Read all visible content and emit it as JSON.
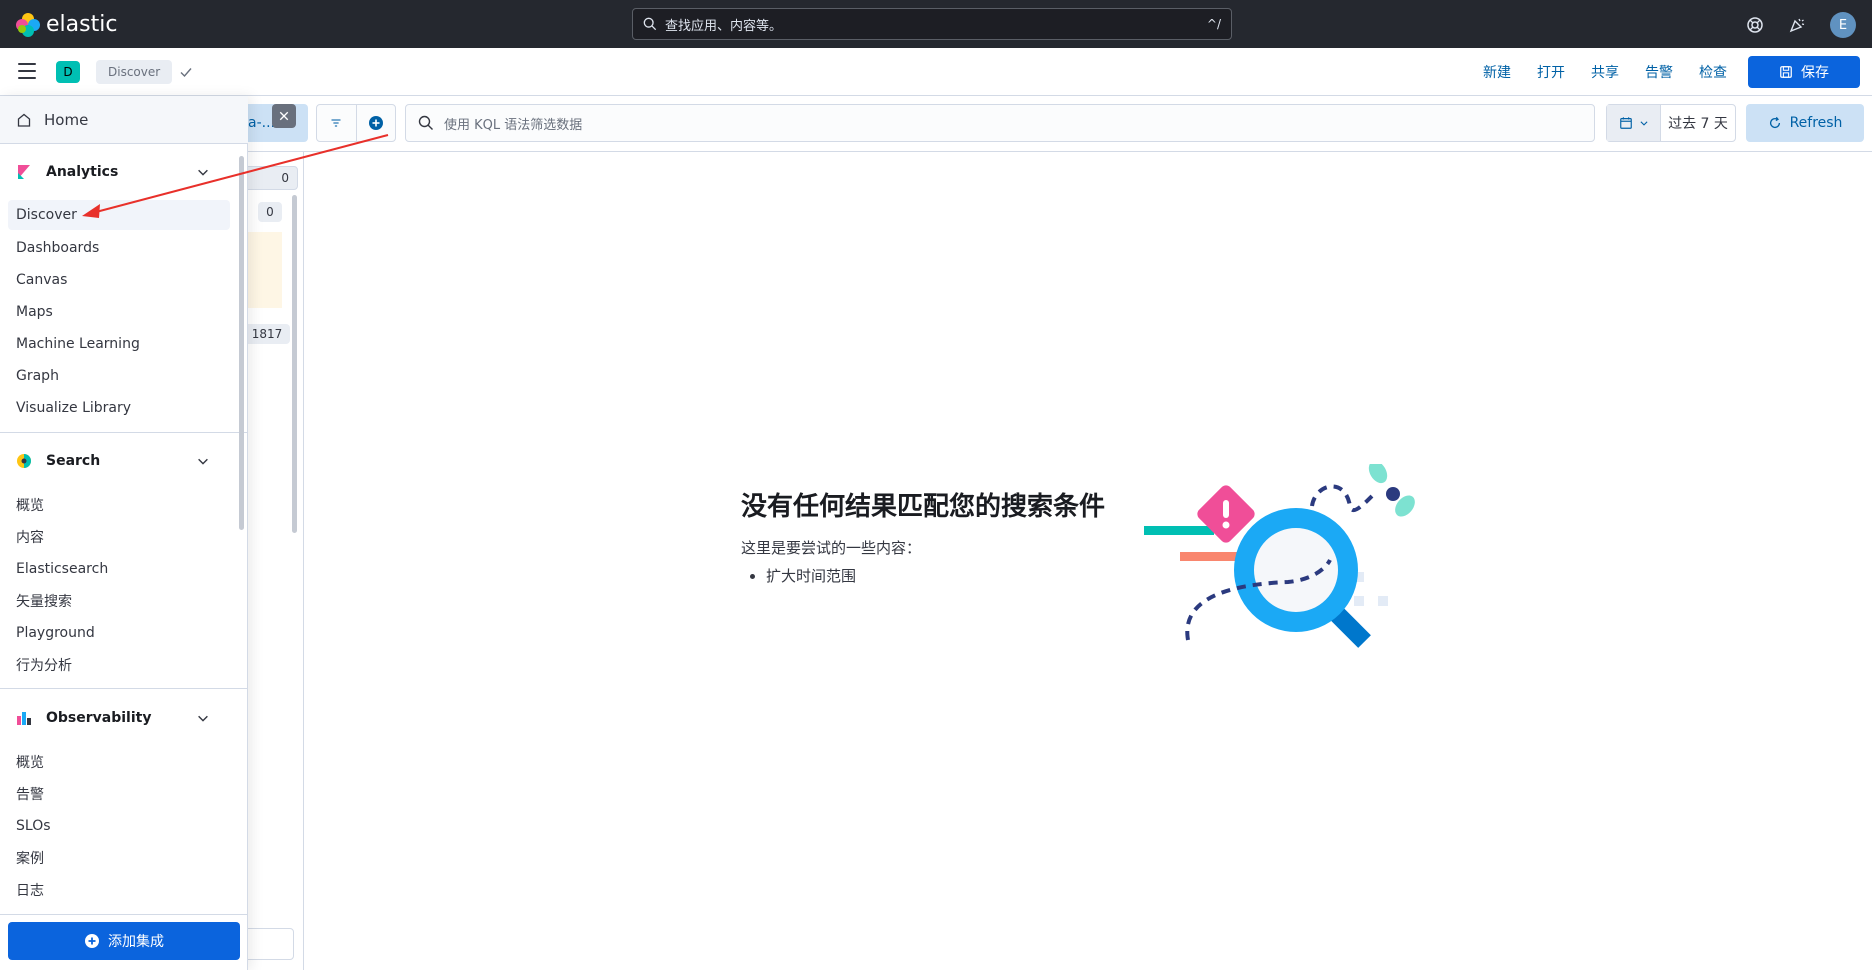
{
  "topbar": {
    "logo_text": "elastic",
    "search_placeholder": "查找应用、内容等。",
    "search_shortcut": "^/",
    "avatar_initial": "E"
  },
  "subbar": {
    "space_initial": "D",
    "breadcrumb": "Discover",
    "actions": [
      "新建",
      "打开",
      "共享",
      "告警",
      "检查"
    ],
    "save_label": "保存"
  },
  "query": {
    "dataview_label": "a-...",
    "kql_placeholder": "使用 KQL 语法筛选数据",
    "time_range": "过去 7 天",
    "refresh_label": "Refresh"
  },
  "field_strip": {
    "pill_1": "0",
    "pill_2": "0",
    "pill_3": "1817"
  },
  "empty_state": {
    "title": "没有任何结果匹配您的搜索条件",
    "subtitle": "这里是要尝试的一些内容：",
    "suggestions": [
      "扩大时间范围"
    ]
  },
  "sidenav": {
    "home": "Home",
    "sections": [
      {
        "title": "Analytics",
        "items": [
          "Discover",
          "Dashboards",
          "Canvas",
          "Maps",
          "Machine Learning",
          "Graph",
          "Visualize Library"
        ]
      },
      {
        "title": "Search",
        "items": [
          "概览",
          "内容",
          "Elasticsearch",
          "矢量搜索",
          "Playground",
          "行为分析"
        ]
      },
      {
        "title": "Observability",
        "items": [
          "概览",
          "告警",
          "SLOs",
          "案例",
          "日志"
        ]
      }
    ],
    "add_integrations": "添加集成"
  },
  "colors": {
    "topbar_bg": "#25282f",
    "primary": "#0b64dd",
    "link": "#0061a6",
    "annotation_arrow": "#e8302a"
  }
}
